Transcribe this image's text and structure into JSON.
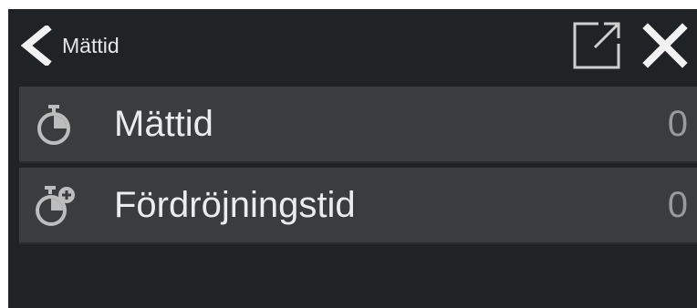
{
  "header": {
    "title": "Mättid",
    "back_icon": "chevron-left-icon",
    "popout_icon": "open-external-icon",
    "close_icon": "close-icon"
  },
  "rows": [
    {
      "label": "Mättid",
      "value": "0",
      "icon": "stopwatch-icon"
    },
    {
      "label": "Fördröjningstid",
      "value": "0",
      "icon": "stopwatch-plus-icon"
    }
  ],
  "colors": {
    "background": "#202326",
    "row": "#3a3c3e",
    "text": "#ececec",
    "value": "#9a9a9a"
  }
}
